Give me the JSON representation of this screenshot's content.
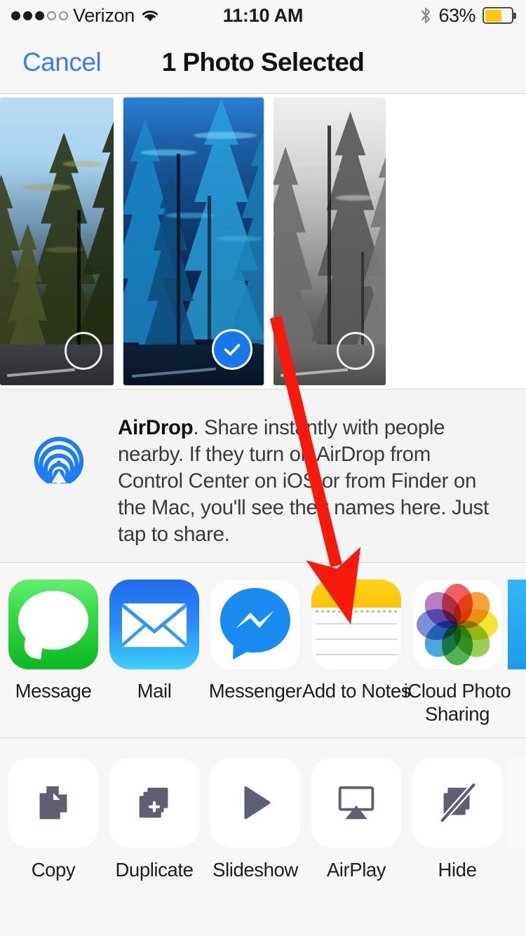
{
  "status_bar": {
    "signal_dots_filled": 3,
    "signal_dots_total": 5,
    "carrier": "Verizon",
    "wifi_icon": "wifi-icon",
    "time": "11:10 AM",
    "bluetooth_icon": "bluetooth-icon",
    "battery_percent": "63%",
    "battery_level": 63,
    "battery_color": "#fdcb0b"
  },
  "nav_bar": {
    "cancel_label": "Cancel",
    "title": "1 Photo Selected",
    "cancel_color": "#3b7bf7"
  },
  "photos": [
    {
      "name": "photo-thumb-1",
      "selected": false,
      "style": "color-forest-road",
      "badge": "empty-circle"
    },
    {
      "name": "photo-thumb-2",
      "selected": true,
      "style": "blue-stylized-forest",
      "badge": "checkmark-circle"
    },
    {
      "name": "photo-thumb-3",
      "selected": false,
      "style": "black-and-white-forest",
      "badge": "empty-circle"
    }
  ],
  "airdrop": {
    "icon": "airdrop-icon",
    "title": "AirDrop",
    "body": ". Share instantly with people nearby. If they turn on AirDrop from Control Center on iOS or from Finder on the Mac, you'll see their names here. Just tap to share.",
    "accent_color": "#1d7ef3"
  },
  "app_row": [
    {
      "label": "Message",
      "icon": "messages-icon"
    },
    {
      "label": "Mail",
      "icon": "mail-icon"
    },
    {
      "label": "Messenger",
      "icon": "messenger-icon"
    },
    {
      "label": "Add to Notes",
      "icon": "notes-icon"
    },
    {
      "label": "iCloud Photo Sharing",
      "icon": "icloud-photo-sharing-icon"
    },
    {
      "label": "",
      "icon": "partial-app-icon"
    }
  ],
  "action_row": [
    {
      "label": "Copy",
      "icon": "copy-icon"
    },
    {
      "label": "Duplicate",
      "icon": "duplicate-icon"
    },
    {
      "label": "Slideshow",
      "icon": "slideshow-play-icon"
    },
    {
      "label": "AirPlay",
      "icon": "airplay-icon"
    },
    {
      "label": "Hide",
      "icon": "hide-icon"
    },
    {
      "label": "",
      "icon": "partial-action-icon"
    }
  ],
  "annotation": {
    "arrow_color": "#f61a0d",
    "arrow_points_to": "Add to Notes"
  }
}
